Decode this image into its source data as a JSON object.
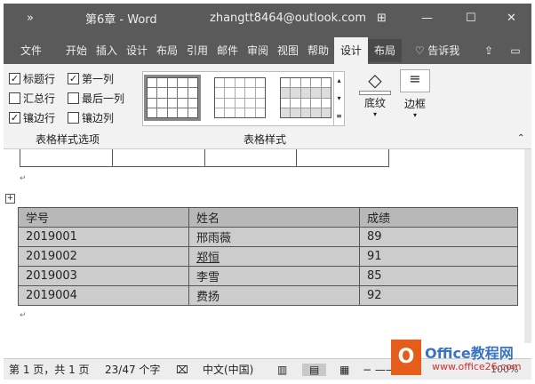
{
  "title": {
    "qat": "»",
    "doc": "第6章 - Word",
    "account": "zhangtt8464@outlook.com",
    "min": "—",
    "max": "☐",
    "close": "✕",
    "ribbon_display": "⊞"
  },
  "tabs": [
    "文件",
    "开始",
    "插入",
    "设计",
    "布局",
    "引用",
    "邮件",
    "审阅",
    "视图",
    "帮助",
    "设计",
    "布局",
    "告诉我"
  ],
  "options": {
    "items": [
      {
        "label": "标题行",
        "checked": true
      },
      {
        "label": "第一列",
        "checked": true
      },
      {
        "label": "汇总行",
        "checked": false
      },
      {
        "label": "最后一列",
        "checked": false
      },
      {
        "label": "镶边行",
        "checked": true
      },
      {
        "label": "镶边列",
        "checked": false
      }
    ],
    "group": "表格样式选项"
  },
  "styles": {
    "group": "表格样式",
    "shading": "底纹",
    "borders": "边框"
  },
  "table": {
    "headers": [
      "学号",
      "姓名",
      "成绩"
    ],
    "rows": [
      [
        "2019001",
        "邢雨薇",
        "89"
      ],
      [
        "2019002",
        "郑恒",
        "91"
      ],
      [
        "2019003",
        "李雪",
        "85"
      ],
      [
        "2019004",
        "费扬",
        "92"
      ]
    ]
  },
  "status": {
    "page": "第 1 页，共 1 页",
    "words": "23/47 个字",
    "lang": "中文(中国)",
    "zoom": "100%"
  },
  "watermark": {
    "brand": "Office教程网",
    "url": "www.office26.com"
  }
}
